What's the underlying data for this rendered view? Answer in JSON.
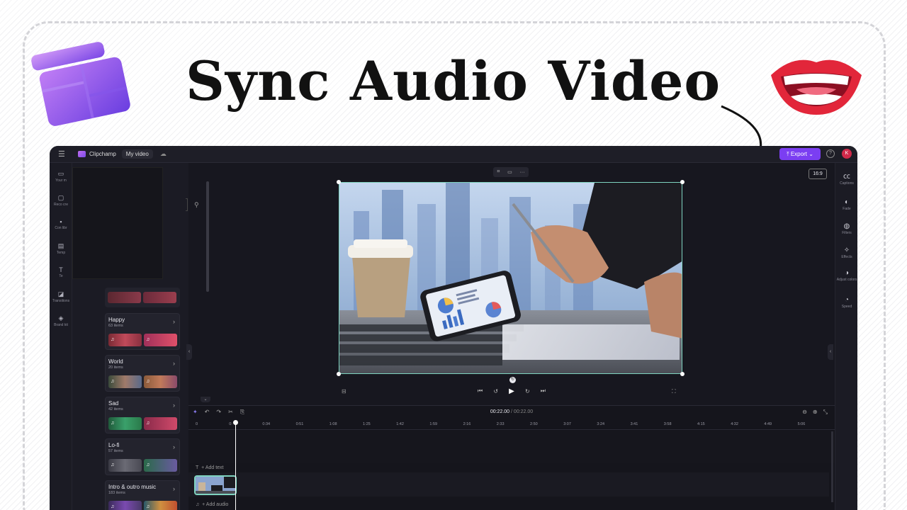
{
  "headline": "Sync Audio Video",
  "app": {
    "brand": "Clipchamp",
    "project_name": "My video",
    "export_label": "Export",
    "help_symbol": "?",
    "avatar_initial": "K"
  },
  "left_nav": [
    {
      "label": "Your m",
      "icon": "media-icon"
    },
    {
      "label": "Reco cre",
      "icon": "record-icon"
    },
    {
      "label": "Con libr",
      "icon": "content-library-icon"
    },
    {
      "label": "Temp",
      "icon": "templates-icon"
    },
    {
      "label": "Te",
      "icon": "text-icon"
    },
    {
      "label": "Transitions",
      "icon": "transitions-icon"
    },
    {
      "label": "Brand kit",
      "icon": "brand-kit-icon"
    }
  ],
  "music_categories": [
    {
      "title": "Happy",
      "count": "63 items"
    },
    {
      "title": "World",
      "count": "20 items"
    },
    {
      "title": "Sad",
      "count": "42 items"
    },
    {
      "title": "Lo-fi",
      "count": "57 items"
    },
    {
      "title": "Intro & outro music",
      "count": "183 items"
    }
  ],
  "right_nav": [
    {
      "label": "Captions",
      "icon": "captions-icon"
    },
    {
      "label": "Fade",
      "icon": "fade-icon"
    },
    {
      "label": "Filters",
      "icon": "filters-icon"
    },
    {
      "label": "Effects",
      "icon": "effects-icon"
    },
    {
      "label": "Adjust colors",
      "icon": "adjust-colors-icon"
    },
    {
      "label": "Speed",
      "icon": "speed-icon"
    }
  ],
  "aspect_ratio": "16:9",
  "timeline": {
    "current_time": "00:22.00",
    "total_time": "/ 00:22.00",
    "ticks": [
      "0",
      "0:",
      "0:34",
      "0:51",
      "1:08",
      "1:25",
      "1:42",
      "1:59",
      "2:16",
      "2:33",
      "2:50",
      "3:07",
      "3:24",
      "3:41",
      "3:58",
      "4:15",
      "4:32",
      "4:49",
      "5:06"
    ],
    "add_text_label": "+ Add text",
    "add_audio_label": "+ Add audio"
  },
  "colors": {
    "accent": "#7b3ef2",
    "selection": "#7fd4c0",
    "app_bg": "#17171f"
  }
}
